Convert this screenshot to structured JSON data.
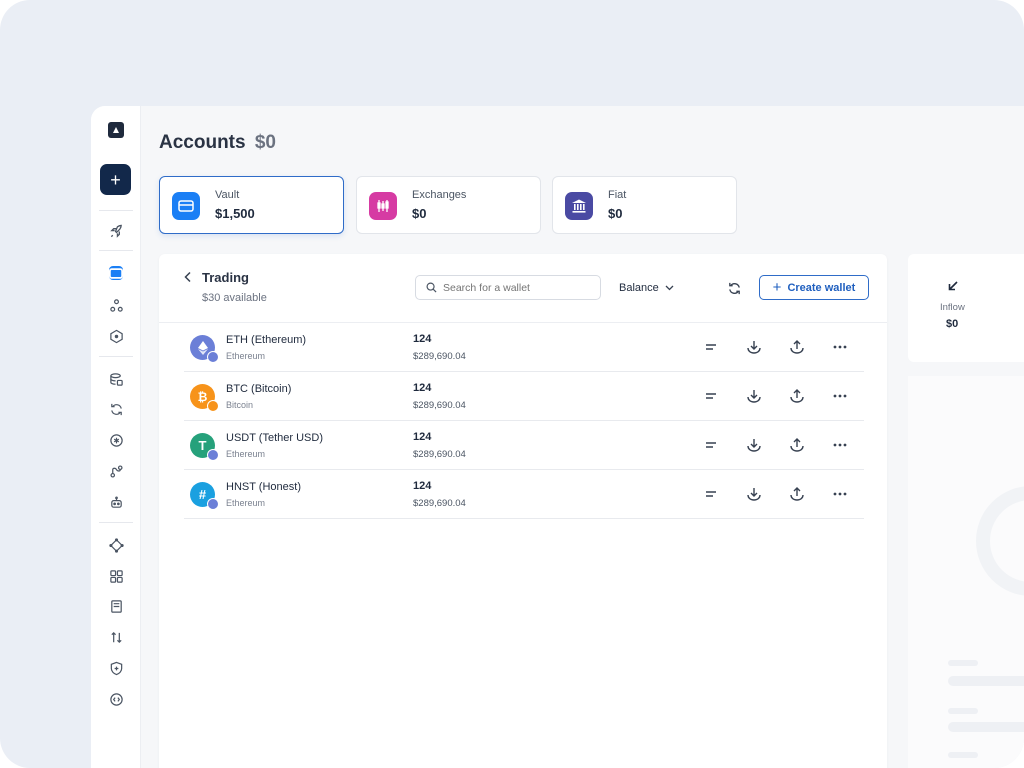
{
  "page": {
    "title": "Accounts",
    "total": "$0"
  },
  "cards": [
    {
      "label": "Vault",
      "value": "$1,500",
      "icon": "wallet-icon",
      "color": "#1b7ff5"
    },
    {
      "label": "Exchanges",
      "value": "$0",
      "icon": "candlestick-icon",
      "color": "#d63ba3"
    },
    {
      "label": "Fiat",
      "value": "$0",
      "icon": "bank-icon",
      "color": "#4a4aa3"
    }
  ],
  "panel": {
    "title": "Trading",
    "subtitle": "$30 available",
    "search_placeholder": "Search for a wallet",
    "sort_label": "Balance",
    "create_label": "Create wallet"
  },
  "wallets": [
    {
      "name": "ETH (Ethereum)",
      "network": "Ethereum",
      "quantity": "124",
      "usd": "$289,690.04",
      "icon": "ethereum-icon",
      "color": "#6b7fd7"
    },
    {
      "name": "BTC (Bitcoin)",
      "network": "Bitcoin",
      "quantity": "124",
      "usd": "$289,690.04",
      "icon": "bitcoin-icon",
      "color": "#f7931a"
    },
    {
      "name": "USDT (Tether USD)",
      "network": "Ethereum",
      "quantity": "124",
      "usd": "$289,690.04",
      "icon": "tether-icon",
      "color": "#26a17b"
    },
    {
      "name": "HNST (Honest)",
      "network": "Ethereum",
      "quantity": "124",
      "usd": "$289,690.04",
      "icon": "honest-icon",
      "color": "#1aa0e0"
    }
  ],
  "flow": {
    "label": "Inflow",
    "value": "$0"
  },
  "colors": {
    "accent": "#2f6cc8",
    "sidebar_primary": "#12284a"
  }
}
